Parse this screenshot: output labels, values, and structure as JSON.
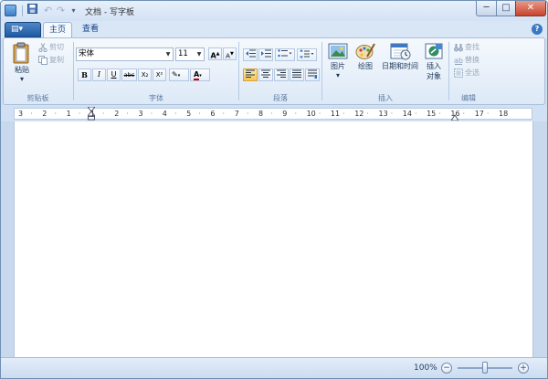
{
  "window": {
    "title": "文档 - 写字板"
  },
  "quick_access": {
    "save_icon": "save-icon",
    "undo_icon": "undo-icon",
    "redo_icon": "redo-icon",
    "customize_icon": "dropdown-arrow-icon"
  },
  "window_controls": {
    "minimize": "─",
    "maximize": "□",
    "close": "✕"
  },
  "tabs": {
    "menu_label": "▤▾",
    "home": "主页",
    "view": "查看",
    "help": "?"
  },
  "clipboard": {
    "label": "剪贴板",
    "paste": "粘贴",
    "paste_arrow": "▾",
    "cut": "剪切",
    "copy": "复制"
  },
  "font": {
    "label": "字体",
    "family": "宋体",
    "size": "11",
    "grow": "A",
    "shrink": "A",
    "bold": "B",
    "italic": "I",
    "underline": "U",
    "strike": "abc",
    "subscript": "X₂",
    "superscript": "X²",
    "highlight": "✎",
    "font_color": "A"
  },
  "paragraph": {
    "label": "段落"
  },
  "insert": {
    "label": "插入",
    "picture": "图片",
    "picture_arrow": "▾",
    "paint": "绘图",
    "datetime": "日期和时间",
    "object_line1": "插入",
    "object_line2": "对象"
  },
  "editing": {
    "label": "编辑",
    "find": "查找",
    "replace": "替换",
    "select_all": "全选"
  },
  "ruler": {
    "labels": [
      "3",
      "2",
      "1",
      "1",
      "2",
      "3",
      "4",
      "5",
      "6",
      "7",
      "8",
      "9",
      "10",
      "11",
      "12",
      "13",
      "14",
      "15",
      "16",
      "17",
      "18"
    ]
  },
  "status": {
    "zoom": "100%",
    "zoom_out": "−",
    "zoom_in": "+",
    "zoom_level": 0.5
  },
  "colors": {
    "accent": "#1e5aa0",
    "ribbon": "#dde9f7",
    "highlight": "#f6c65a",
    "font_color_bar": "#c00000"
  }
}
